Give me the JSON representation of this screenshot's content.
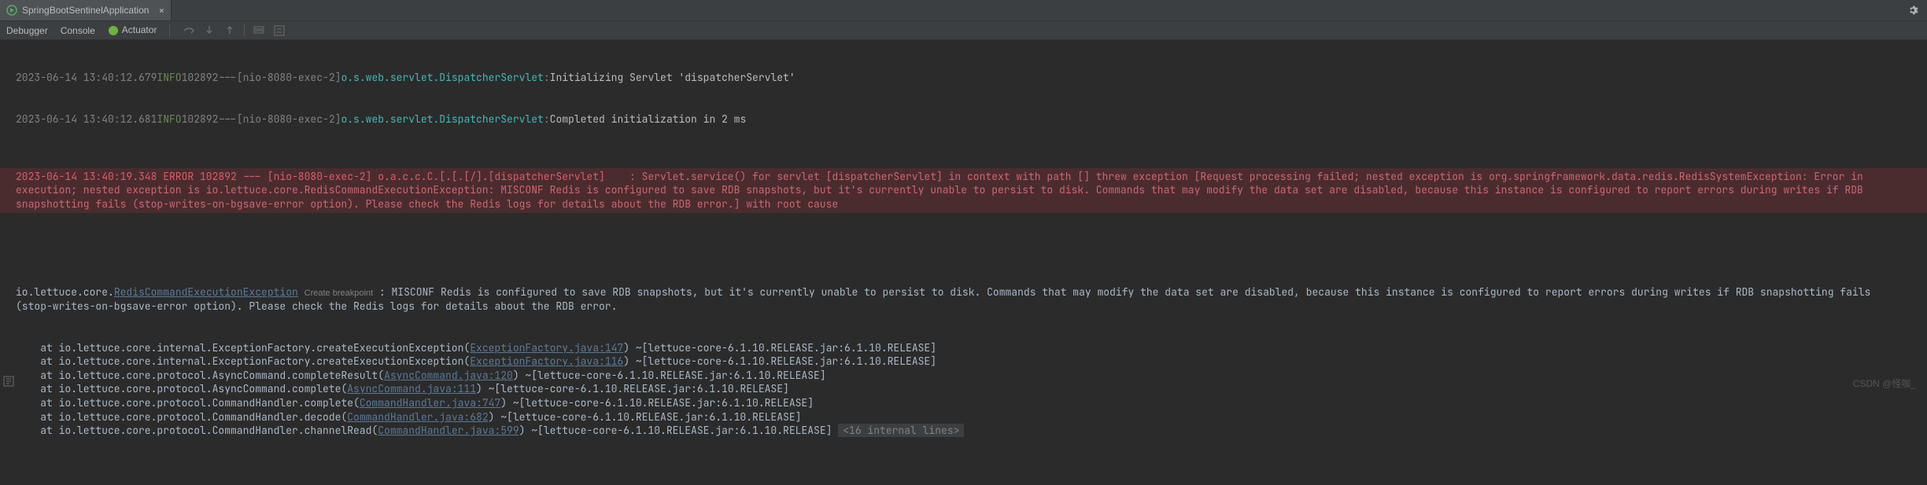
{
  "tab": {
    "label": "SpringBootSentinelApplication",
    "icon": "run-icon"
  },
  "toolbar": {
    "debugger": "Debugger",
    "console": "Console",
    "actuator": "Actuator"
  },
  "log": {
    "line1": {
      "ts": "2023-06-14 13:40:12.679",
      "level": "INFO",
      "pid": "102892",
      "sep": "---",
      "thread": "[nio-8080-exec-2]",
      "logger": "o.s.web.servlet.DispatcherServlet",
      "colon": ":",
      "msg": "Initializing Servlet 'dispatcherServlet'"
    },
    "line2": {
      "ts": "2023-06-14 13:40:12.681",
      "level": "INFO",
      "pid": "102892",
      "sep": "---",
      "thread": "[nio-8080-exec-2]",
      "logger": "o.s.web.servlet.DispatcherServlet",
      "colon": ":",
      "msg": "Completed initialization in 2 ms"
    }
  },
  "error": {
    "prefix": "2023-06-14 13:40:19.348 ERROR 102892 --- [nio-8080-exec-2] o.a.c.c.C.[.[.[/].[dispatcherServlet]    : ",
    "body": "Servlet.service() for servlet [dispatcherServlet] in context with path [] threw exception [Request processing failed; nested exception is org.springframework.data.redis.RedisSystemException: Error in execution; nested exception is io.lettuce.core.RedisCommandExecutionException: MISCONF Redis is configured to save RDB snapshots, but it's currently unable to persist to disk. Commands that may modify the data set are disabled, because this instance is configured to report errors during writes if RDB snapshotting fails (stop-writes-on-bgsave-error option). Please check the Redis logs for details about the RDB error.] with root cause"
  },
  "exception": {
    "pkg": "io.lettuce.core.",
    "class": "RedisCommandExecutionException",
    "breakpoint": "Create breakpoint",
    "msg": ": MISCONF Redis is configured to save RDB snapshots, but it's currently unable to persist to disk. Commands that may modify the data set are disabled, because this instance is configured to report errors during writes if RDB snapshotting fails (stop-writes-on-bgsave-error option). Please check the Redis logs for details about the RDB error."
  },
  "stack": [
    {
      "pre": "    at io.lettuce.core.internal.ExceptionFactory.createExecutionException(",
      "link": "ExceptionFactory.java:147",
      "post": ") ~[lettuce-core-6.1.10.RELEASE.jar:6.1.10.RELEASE]"
    },
    {
      "pre": "    at io.lettuce.core.internal.ExceptionFactory.createExecutionException(",
      "link": "ExceptionFactory.java:116",
      "post": ") ~[lettuce-core-6.1.10.RELEASE.jar:6.1.10.RELEASE]"
    },
    {
      "pre": "    at io.lettuce.core.protocol.AsyncCommand.completeResult(",
      "link": "AsyncCommand.java:120",
      "post": ") ~[lettuce-core-6.1.10.RELEASE.jar:6.1.10.RELEASE]"
    },
    {
      "pre": "    at io.lettuce.core.protocol.AsyncCommand.complete(",
      "link": "AsyncCommand.java:111",
      "post": ") ~[lettuce-core-6.1.10.RELEASE.jar:6.1.10.RELEASE]"
    },
    {
      "pre": "    at io.lettuce.core.protocol.CommandHandler.complete(",
      "link": "CommandHandler.java:747",
      "post": ") ~[lettuce-core-6.1.10.RELEASE.jar:6.1.10.RELEASE]"
    },
    {
      "pre": "    at io.lettuce.core.protocol.CommandHandler.decode(",
      "link": "CommandHandler.java:682",
      "post": ") ~[lettuce-core-6.1.10.RELEASE.jar:6.1.10.RELEASE]"
    },
    {
      "pre": "    at io.lettuce.core.protocol.CommandHandler.channelRead(",
      "link": "CommandHandler.java:599",
      "post": ") ~[lettuce-core-6.1.10.RELEASE.jar:6.1.10.RELEASE] ",
      "internal": "<16 internal lines>"
    }
  ],
  "watermark": "CSDN @怪咖_"
}
